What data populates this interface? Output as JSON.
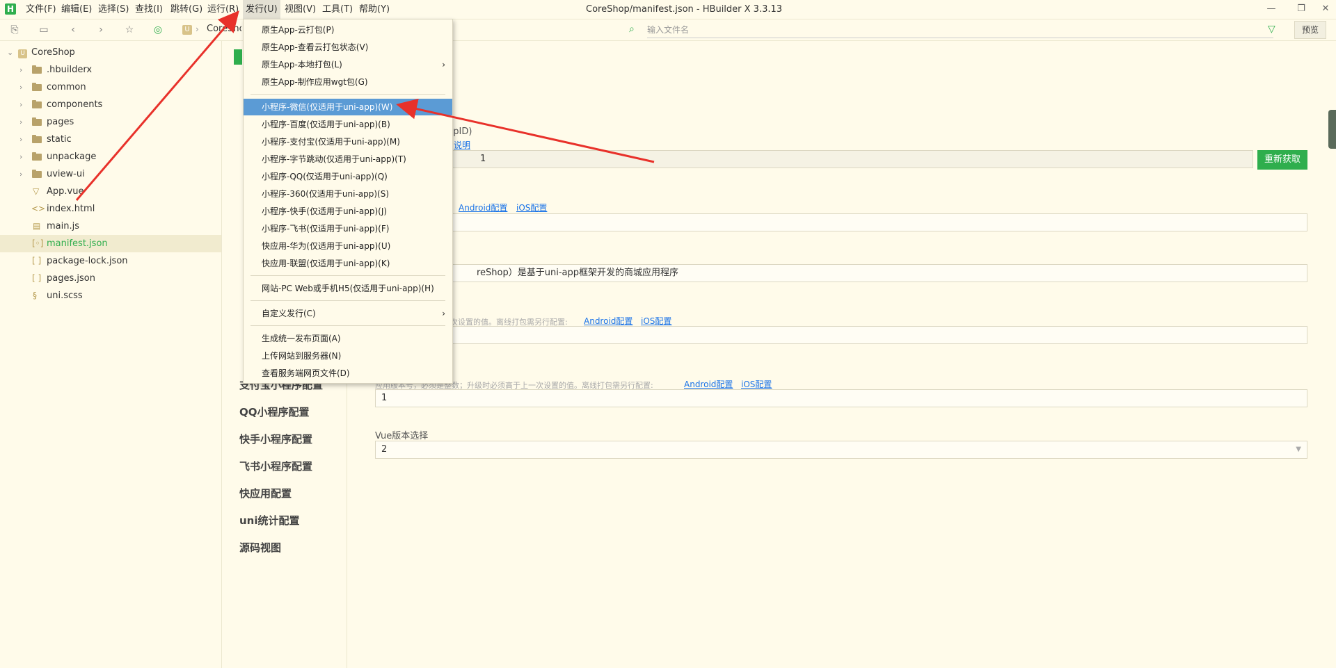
{
  "menubar": {
    "items": [
      {
        "label": "文件(F)"
      },
      {
        "label": "编辑(E)"
      },
      {
        "label": "选择(S)"
      },
      {
        "label": "查找(I)"
      },
      {
        "label": "跳转(G)"
      },
      {
        "label": "运行(R)"
      },
      {
        "label": "发行(U)"
      },
      {
        "label": "视图(V)"
      },
      {
        "label": "工具(T)"
      },
      {
        "label": "帮助(Y)"
      }
    ],
    "active_index": 6
  },
  "window": {
    "title": "CoreShop/manifest.json - HBuilder X 3.3.13"
  },
  "toolbar": {
    "breadcrumb": "CoreShop",
    "file_search_placeholder": "输入文件名",
    "preview_label": "预览"
  },
  "sidebar": {
    "items": [
      {
        "label": "CoreShop",
        "kind": "project"
      },
      {
        "label": ".hbuilderx",
        "kind": "folder"
      },
      {
        "label": "common",
        "kind": "folder"
      },
      {
        "label": "components",
        "kind": "folder"
      },
      {
        "label": "pages",
        "kind": "folder"
      },
      {
        "label": "static",
        "kind": "folder"
      },
      {
        "label": "unpackage",
        "kind": "folder"
      },
      {
        "label": "uview-ui",
        "kind": "folder"
      },
      {
        "label": "App.vue",
        "kind": "vue"
      },
      {
        "label": "index.html",
        "kind": "html"
      },
      {
        "label": "main.js",
        "kind": "js"
      },
      {
        "label": "manifest.json",
        "kind": "manifest"
      },
      {
        "label": "package-lock.json",
        "kind": "json"
      },
      {
        "label": "pages.json",
        "kind": "json"
      },
      {
        "label": "uni.scss",
        "kind": "scss"
      }
    ],
    "selected_index": 11
  },
  "settings_nav": {
    "items": [
      {
        "label": "支付宝小程序配置"
      },
      {
        "label": "QQ小程序配置"
      },
      {
        "label": "快手小程序配置"
      },
      {
        "label": "飞书小程序配置"
      },
      {
        "label": "快应用配置"
      },
      {
        "label": "uni统计配置"
      },
      {
        "label": "源码视图"
      }
    ]
  },
  "content": {
    "appid_label": "ppID)",
    "appid_link": "说明",
    "appid_value": "1",
    "refresh_label": "重新获取",
    "name_links": {
      "android": "Android配置",
      "ios": "iOS配置"
    },
    "desc_value": "reShop）是基于uni-app框架开发的商城应用程序",
    "version_name_help": "次设置的值。离线打包需另行配置:",
    "version_name_links": {
      "android": "Android配置",
      "ios": "iOS配置"
    },
    "version_code_help": "应用版本号，必须是整数；升级时必须高于上一次设置的值。离线打包需另行配置:",
    "version_code_links": {
      "android": "Android配置",
      "ios": "iOS配置"
    },
    "version_code_value": "1",
    "vue_label": "Vue版本选择",
    "vue_value": "2"
  },
  "publish_menu": {
    "items": [
      {
        "label": "原生App-云打包(P)",
        "submenu": false
      },
      {
        "label": "原生App-查看云打包状态(V)",
        "submenu": false
      },
      {
        "label": "原生App-本地打包(L)",
        "submenu": true
      },
      {
        "label": "原生App-制作应用wgt包(G)",
        "submenu": false
      },
      {
        "label": "小程序-微信(仅适用于uni-app)(W)",
        "submenu": false,
        "highlight": true
      },
      {
        "label": "小程序-百度(仅适用于uni-app)(B)",
        "submenu": false
      },
      {
        "label": "小程序-支付宝(仅适用于uni-app)(M)",
        "submenu": false
      },
      {
        "label": "小程序-字节跳动(仅适用于uni-app)(T)",
        "submenu": false
      },
      {
        "label": "小程序-QQ(仅适用于uni-app)(Q)",
        "submenu": false
      },
      {
        "label": "小程序-360(仅适用于uni-app)(S)",
        "submenu": false
      },
      {
        "label": "小程序-快手(仅适用于uni-app)(J)",
        "submenu": false
      },
      {
        "label": "小程序-飞书(仅适用于uni-app)(F)",
        "submenu": false
      },
      {
        "label": "快应用-华为(仅适用于uni-app)(U)",
        "submenu": false
      },
      {
        "label": "快应用-联盟(仅适用于uni-app)(K)",
        "submenu": false
      },
      {
        "label": "网站-PC Web或手机H5(仅适用于uni-app)(H)",
        "submenu": false
      },
      {
        "label": "自定义发行(C)",
        "submenu": true
      },
      {
        "label": "生成统一发布页面(A)",
        "submenu": false
      },
      {
        "label": "上传网站到服务器(N)",
        "submenu": false
      },
      {
        "label": "查看服务端网页文件(D)",
        "submenu": false
      }
    ]
  },
  "colors": {
    "accent": "#2fae4d",
    "highlight": "#5b9bd5",
    "annotation": "#e8312a",
    "background": "#fffbea"
  }
}
